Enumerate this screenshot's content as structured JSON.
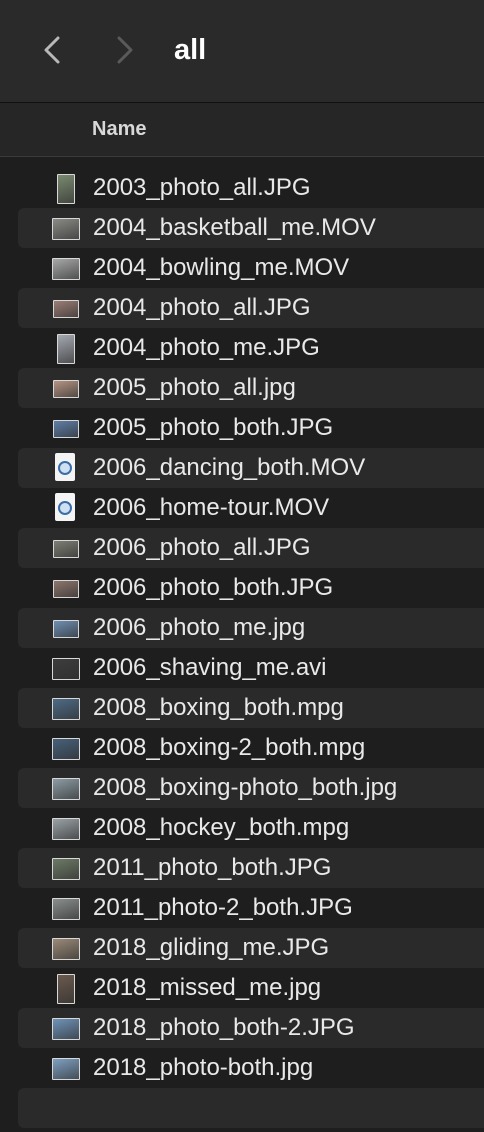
{
  "window": {
    "title": "all"
  },
  "toolbar": {
    "back_icon": "chevron-left-icon",
    "forward_icon": "chevron-right-icon"
  },
  "columns": {
    "name": "Name"
  },
  "files": [
    {
      "name": "2003_photo_all.JPG",
      "thumb": "portrait",
      "color": "#7a8a70"
    },
    {
      "name": "2004_basketball_me.MOV",
      "thumb": "landscape",
      "color": "#8a8a86"
    },
    {
      "name": "2004_bowling_me.MOV",
      "thumb": "landscape",
      "color": "#a7a9a8"
    },
    {
      "name": "2004_photo_all.JPG",
      "thumb": "small",
      "color": "#9c7e76"
    },
    {
      "name": "2004_photo_me.JPG",
      "thumb": "portrait",
      "color": "#a4a8b0"
    },
    {
      "name": "2005_photo_all.jpg",
      "thumb": "small",
      "color": "#b59483"
    },
    {
      "name": "2005_photo_both.JPG",
      "thumb": "small",
      "color": "#5f7fa8"
    },
    {
      "name": "2006_dancing_both.MOV",
      "thumb": "doc",
      "color": "#f4f4f4"
    },
    {
      "name": "2006_home-tour.MOV",
      "thumb": "doc",
      "color": "#f4f4f4"
    },
    {
      "name": "2006_photo_all.JPG",
      "thumb": "small",
      "color": "#7d7f74"
    },
    {
      "name": "2006_photo_both.JPG",
      "thumb": "small",
      "color": "#8d766c"
    },
    {
      "name": "2006_photo_me.jpg",
      "thumb": "small",
      "color": "#6f8fb2"
    },
    {
      "name": "2006_shaving_me.avi",
      "thumb": "landscape",
      "color": "#3d3d3d"
    },
    {
      "name": "2008_boxing_both.mpg",
      "thumb": "landscape",
      "color": "#4e6b86"
    },
    {
      "name": "2008_boxing-2_both.mpg",
      "thumb": "landscape",
      "color": "#47617a"
    },
    {
      "name": "2008_boxing-photo_both.jpg",
      "thumb": "landscape",
      "color": "#8c9ca4"
    },
    {
      "name": "2008_hockey_both.mpg",
      "thumb": "landscape",
      "color": "#9aa2a6"
    },
    {
      "name": "2011_photo_both.JPG",
      "thumb": "landscape",
      "color": "#6d7a66"
    },
    {
      "name": "2011_photo-2_both.JPG",
      "thumb": "landscape",
      "color": "#8a8f8e"
    },
    {
      "name": "2018_gliding_me.JPG",
      "thumb": "landscape",
      "color": "#9b8a78"
    },
    {
      "name": "2018_missed_me.jpg",
      "thumb": "portrait",
      "color": "#6a5a4e"
    },
    {
      "name": "2018_photo_both-2.JPG",
      "thumb": "landscape",
      "color": "#6f93b8"
    },
    {
      "name": "2018_photo-both.jpg",
      "thumb": "landscape",
      "color": "#7ea0c2"
    }
  ]
}
